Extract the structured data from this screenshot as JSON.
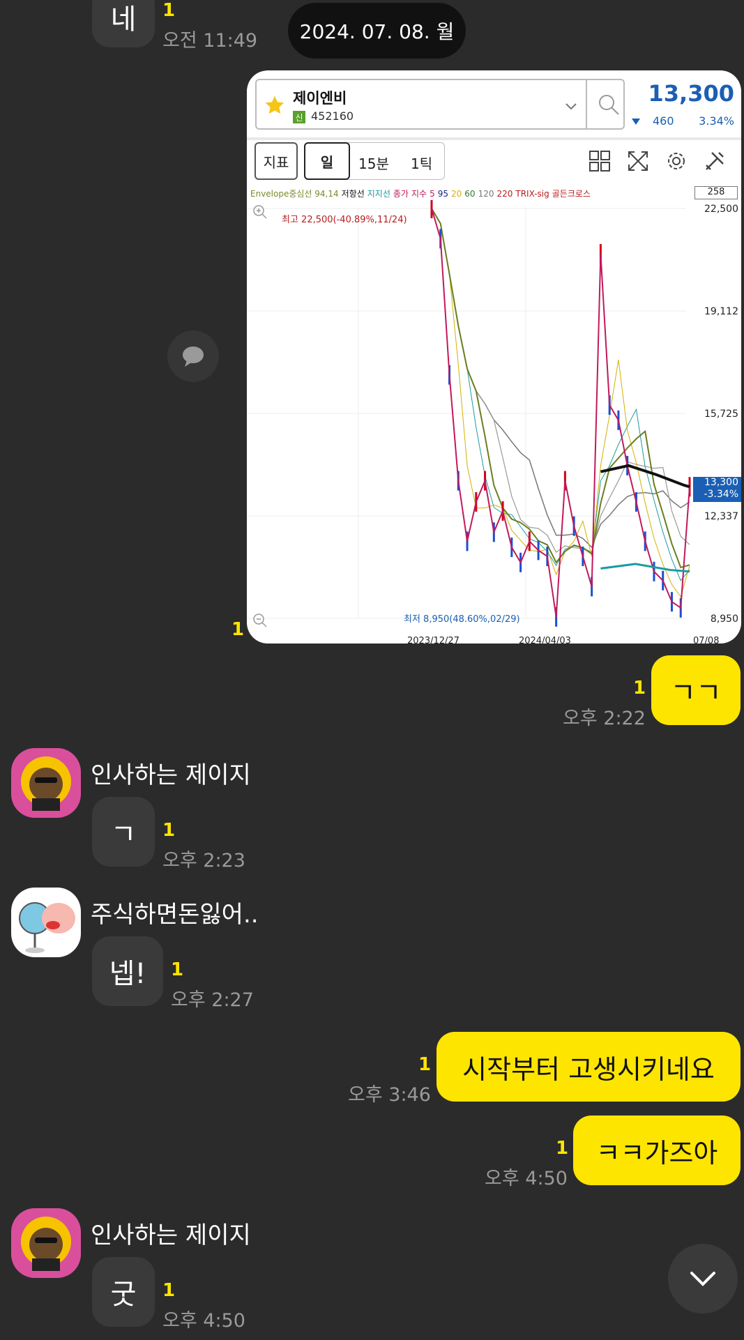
{
  "messages": {
    "m0": {
      "text": "네",
      "unread": "1",
      "time": "오전 11:49"
    },
    "date_pill": "2024. 07. 08. 월",
    "m1": {
      "unread": "1"
    },
    "m2": {
      "text": "ㄱㄱ",
      "unread": "1",
      "time": "오후 2:22"
    },
    "m3": {
      "sender": "인사하는 제이지",
      "text": "ㄱ",
      "unread": "1",
      "time": "오후 2:23"
    },
    "m4": {
      "sender": "주식하면돈잃어..",
      "text": "넵!",
      "unread": "1",
      "time": "오후 2:27"
    },
    "m5": {
      "text": "시작부터 고생시키네요",
      "unread": "1",
      "time": "오후 3:46"
    },
    "m6": {
      "text": "ㅋㅋ가즈아",
      "unread": "1",
      "time": "오후 4:50"
    },
    "m7": {
      "sender": "인사하는 제이지",
      "text": "굿",
      "unread": "1",
      "time": "오후 4:50"
    }
  },
  "stock": {
    "name": "제이엔비",
    "badge": "신",
    "code": "452160",
    "price": "13,300",
    "change": "460",
    "change_pct": "3.34%",
    "toolbar": {
      "indicator": "지표",
      "day": "일",
      "min15": "15분",
      "tick": "1틱"
    },
    "legend": {
      "envelope": "Envelope중심선 94,14",
      "resist": "저항선",
      "support": "지지선",
      "close": "종가",
      "index": "지수",
      "ma5": "5",
      "ma95": "95",
      "ma20": "20",
      "ma60": "60",
      "ma120": "120",
      "ma220": "220",
      "trix": "TRIX-sig",
      "golden": "골든크로스"
    },
    "count_box": "258",
    "annot_high": "최고 22,500(-40.89%,11/24)",
    "annot_low": "최저 8,950(48.60%,02/29)",
    "price_tag": "13,300",
    "price_tag_pct": "-3.34%",
    "colors": {
      "up": "#d0021b",
      "down": "#1b4fd0",
      "accent": "#1a5fb4"
    }
  },
  "chart_data": {
    "type": "line",
    "ylim": [
      8950,
      22500
    ],
    "yticks": [
      "22,500",
      "19,112",
      "15,725",
      "12,337",
      "8,950"
    ],
    "xticks": [
      "2023/12/27",
      "2024/04/03",
      "07/08"
    ],
    "series": [
      {
        "values": [
          22500,
          21500,
          17000,
          13500,
          11500,
          12800,
          13500,
          11800,
          12500,
          11300,
          10800,
          11500,
          11200,
          11000,
          9000,
          13500,
          12000,
          11000,
          10000,
          21000,
          16000,
          15500,
          14000,
          12800,
          11500,
          10500,
          10200,
          9500,
          9300,
          13300
        ]
      }
    ]
  },
  "scroll_down_icon": "chevron-down-icon"
}
